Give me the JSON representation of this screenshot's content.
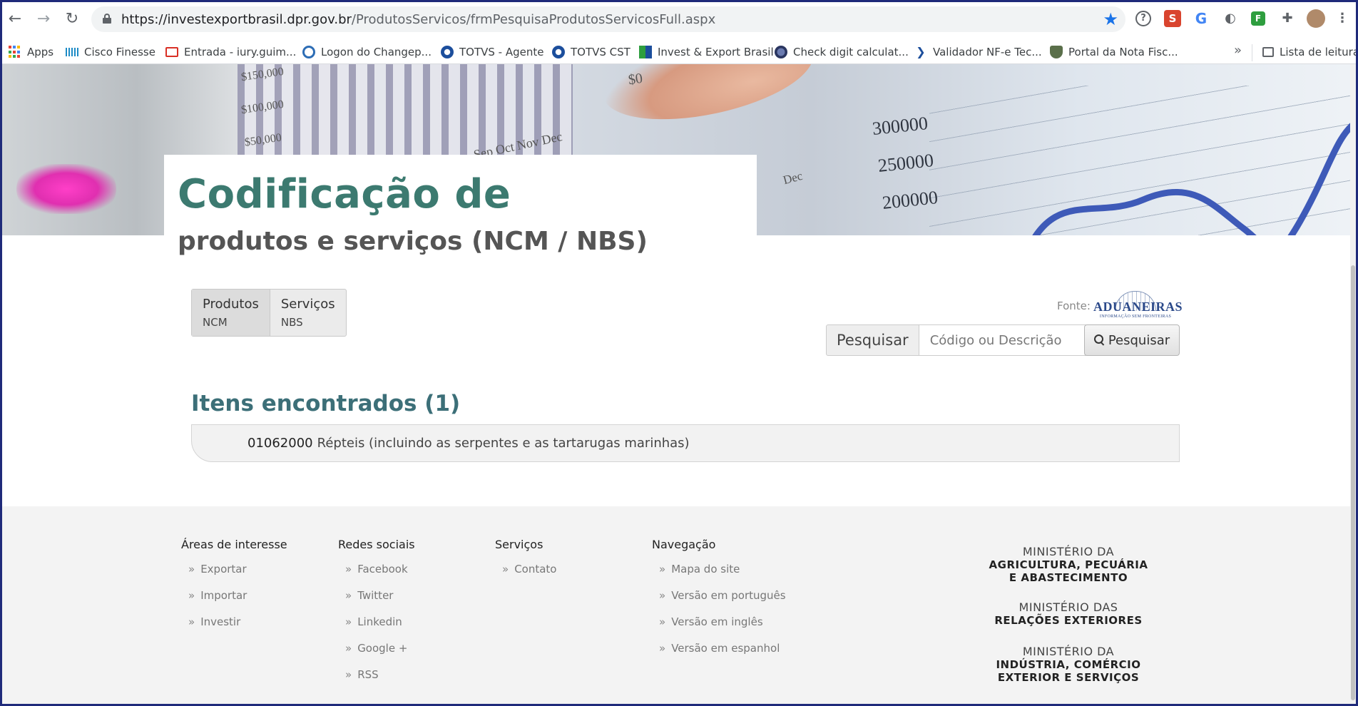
{
  "browser": {
    "url_host": "https://investexportbrasil.dpr.gov.br",
    "url_path": "/ProdutosServicos/frmPesquisaProdutosServicosFull.aspx",
    "bookmarks": [
      {
        "label": "Apps"
      },
      {
        "label": "Cisco Finesse"
      },
      {
        "label": "Entrada - iury.guim..."
      },
      {
        "label": "Logon do Changep..."
      },
      {
        "label": "TOTVS - Agente"
      },
      {
        "label": "TOTVS CST"
      },
      {
        "label": "Invest & Export Brasil"
      },
      {
        "label": "Check digit calculat..."
      },
      {
        "label": "Validador NF-e Tec..."
      },
      {
        "label": "Portal da Nota Fisc..."
      }
    ],
    "more_label": "»",
    "reading_list": "Lista de leitura"
  },
  "hero": {
    "numbers": [
      "300000",
      "250000",
      "200000"
    ],
    "axis": [
      "$150,000",
      "$100,000",
      "$50,000",
      "$0",
      "Sep Oct Nov Dec",
      "Dec"
    ]
  },
  "page": {
    "title_line1": "Codificação de",
    "title_line2": "produtos e serviços (NCM / NBS)"
  },
  "tabs": [
    {
      "label": "Produtos",
      "sub": "NCM"
    },
    {
      "label": "Serviços",
      "sub": "NBS"
    }
  ],
  "source": {
    "label": "Fonte:",
    "logo_text": "ADUANEIRAS",
    "logo_sub": "INFORMAÇÃO SEM FRONTEIRAS"
  },
  "search": {
    "addon_label": "Pesquisar",
    "placeholder": "Código ou Descrição",
    "button_label": "Pesquisar"
  },
  "results": {
    "title": "Itens encontrados (1)",
    "items": [
      {
        "code": "01062000",
        "description": "Répteis (incluindo as serpentes e as tartarugas marinhas)"
      }
    ]
  },
  "footer": {
    "columns": [
      {
        "heading": "Áreas de interesse",
        "links": [
          "Exportar",
          "Importar",
          "Investir"
        ]
      },
      {
        "heading": "Redes sociais",
        "links": [
          "Facebook",
          "Twitter",
          "Linkedin",
          "Google +",
          "RSS"
        ]
      },
      {
        "heading": "Serviços",
        "links": [
          "Contato"
        ]
      },
      {
        "heading": "Navegação",
        "links": [
          "Mapa do site",
          "Versão em português",
          "Versão em inglês",
          "Versão em espanhol"
        ]
      }
    ],
    "ministries": [
      {
        "lead": "MINISTÉRIO DA",
        "line1": "AGRICULTURA, PECUÁRIA",
        "line2": "E ABASTECIMENTO"
      },
      {
        "lead": "MINISTÉRIO DAS",
        "line1": "RELAÇÕES EXTERIORES",
        "line2": ""
      },
      {
        "lead": "MINISTÉRIO DA",
        "line1": "INDÚSTRIA, COMÉRCIO",
        "line2": "EXTERIOR E SERVIÇOS"
      }
    ],
    "link_bullet": "»"
  },
  "colors": {
    "title_teal": "#3c7a70",
    "results_title": "#3c6f78",
    "star_blue": "#1a73e8",
    "frame": "#1f2a7a"
  }
}
